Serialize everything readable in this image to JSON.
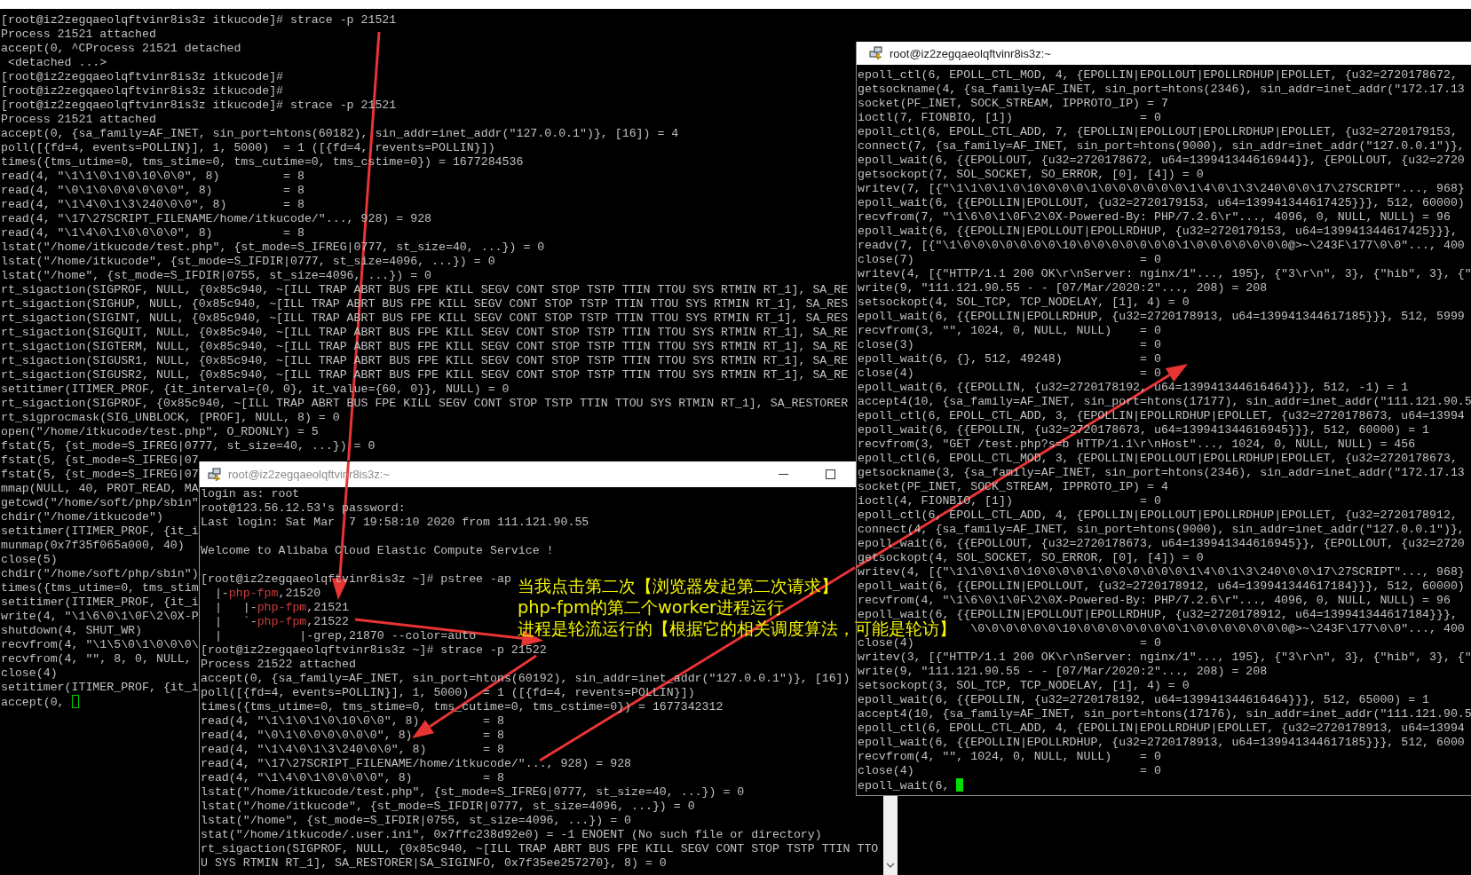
{
  "back_terminal": {
    "lines": [
      "[root@iz2zegqaeolqftvinr8is3z itkucode]# strace -p 21521",
      "Process 21521 attached",
      "accept(0, ^CProcess 21521 detached",
      " <detached ...>",
      "[root@iz2zegqaeolqftvinr8is3z itkucode]#",
      "[root@iz2zegqaeolqftvinr8is3z itkucode]#",
      "[root@iz2zegqaeolqftvinr8is3z itkucode]# strace -p 21521",
      "Process 21521 attached",
      "accept(0, {sa_family=AF_INET, sin_port=htons(60182), sin_addr=inet_addr(\"127.0.0.1\")}, [16]) = 4",
      "poll([{fd=4, events=POLLIN}], 1, 5000)  = 1 ([{fd=4, revents=POLLIN}])",
      "times({tms_utime=0, tms_stime=0, tms_cutime=0, tms_cstime=0}) = 1677284536",
      "read(4, \"\\1\\1\\0\\1\\0\\10\\0\\0\", 8)         = 8",
      "read(4, \"\\0\\1\\0\\0\\0\\0\\0\\0\", 8)          = 8",
      "read(4, \"\\1\\4\\0\\1\\3\\240\\0\\0\", 8)        = 8",
      "read(4, \"\\17\\27SCRIPT_FILENAME/home/itkucode/\"..., 928) = 928",
      "read(4, \"\\1\\4\\0\\1\\0\\0\\0\\0\", 8)          = 8",
      "lstat(\"/home/itkucode/test.php\", {st_mode=S_IFREG|0777, st_size=40, ...}) = 0",
      "lstat(\"/home/itkucode\", {st_mode=S_IFDIR|0777, st_size=4096, ...}) = 0",
      "lstat(\"/home\", {st_mode=S_IFDIR|0755, st_size=4096, ...}) = 0",
      "rt_sigaction(SIGPROF, NULL, {0x85c940, ~[ILL TRAP ABRT BUS FPE KILL SEGV CONT STOP TSTP TTIN TTOU SYS RTMIN RT_1], SA_RE",
      "rt_sigaction(SIGHUP, NULL, {0x85c940, ~[ILL TRAP ABRT BUS FPE KILL SEGV CONT STOP TSTP TTIN TTOU SYS RTMIN RT_1], SA_RES",
      "rt_sigaction(SIGINT, NULL, {0x85c940, ~[ILL TRAP ABRT BUS FPE KILL SEGV CONT STOP TSTP TTIN TTOU SYS RTMIN RT_1], SA_RES",
      "rt_sigaction(SIGQUIT, NULL, {0x85c940, ~[ILL TRAP ABRT BUS FPE KILL SEGV CONT STOP TSTP TTIN TTOU SYS RTMIN RT_1], SA_RE",
      "rt_sigaction(SIGTERM, NULL, {0x85c940, ~[ILL TRAP ABRT BUS FPE KILL SEGV CONT STOP TSTP TTIN TTOU SYS RTMIN RT_1], SA_RE",
      "rt_sigaction(SIGUSR1, NULL, {0x85c940, ~[ILL TRAP ABRT BUS FPE KILL SEGV CONT STOP TSTP TTIN TTOU SYS RTMIN RT_1], SA_RE",
      "rt_sigaction(SIGUSR2, NULL, {0x85c940, ~[ILL TRAP ABRT BUS FPE KILL SEGV CONT STOP TSTP TTIN TTOU SYS RTMIN RT_1], SA_RE",
      "setitimer(ITIMER_PROF, {it_interval={0, 0}, it_value={60, 0}}, NULL) = 0",
      "rt_sigaction(SIGPROF, {0x85c940, ~[ILL TRAP ABRT BUS FPE KILL SEGV CONT STOP TSTP TTIN TTOU SYS RTMIN RT_1], SA_RESTORER",
      "rt_sigprocmask(SIG_UNBLOCK, [PROF], NULL, 8) = 0",
      "open(\"/home/itkucode/test.php\", O_RDONLY) = 5",
      "fstat(5, {st_mode=S_IFREG|0777, st_size=40, ...}) = 0",
      "fstat(5, {st_mode=S_IFREG|07",
      "fstat(5, {st_mode=S_IFREG|07",
      "mmap(NULL, 40, PROT_READ, MA",
      "getcwd(\"/home/soft/php/sbin\"",
      "chdir(\"/home/itkucode\")",
      "setitimer(ITIMER_PROF, {it_i",
      "munmap(0x7f35f065a000, 40)",
      "close(5)",
      "chdir(\"/home/soft/php/sbin\")",
      "times({tms_utime=0, tms_stim",
      "setitimer(ITIMER_PROF, {it_i",
      "write(4, \"\\1\\6\\0\\1\\0F\\2\\0X-P",
      "shutdown(4, SHUT_WR)",
      "recvfrom(4, \"\\1\\5\\0\\1\\0\\0\\0\\",
      "recvfrom(4, \"\", 8, 0, NULL,",
      "close(4)",
      "setitimer(ITIMER_PROF, {it_i",
      {
        "kind": "prompt",
        "text": "accept(0, ",
        "cursor_filled": false
      }
    ]
  },
  "right_terminal": {
    "title": "root@iz2zegqaeolqftvinr8is3z:~",
    "active": true,
    "lines": [
      "epoll_ctl(6, EPOLL_CTL_MOD, 4, {EPOLLIN|EPOLLOUT|EPOLLRDHUP|EPOLLET, {u32=2720178672,",
      "getsockname(4, {sa_family=AF_INET, sin_port=htons(2346), sin_addr=inet_addr(\"172.17.13",
      "socket(PF_INET, SOCK_STREAM, IPPROTO_IP) = 7",
      "ioctl(7, FIONBIO, [1])                  = 0",
      "epoll_ctl(6, EPOLL_CTL_ADD, 7, {EPOLLIN|EPOLLOUT|EPOLLRDHUP|EPOLLET, {u32=2720179153,",
      "connect(7, {sa_family=AF_INET, sin_port=htons(9000), sin_addr=inet_addr(\"127.0.0.1\")},",
      "epoll_wait(6, {{EPOLLOUT, {u32=2720178672, u64=139941344616944}}, {EPOLLOUT, {u32=2720",
      "getsockopt(7, SOL_SOCKET, SO_ERROR, [0], [4]) = 0",
      "writev(7, [{\"\\1\\1\\0\\1\\0\\10\\0\\0\\0\\1\\0\\0\\0\\0\\0\\0\\1\\4\\0\\1\\3\\240\\0\\0\\17\\27SCRIPT\"..., 968}",
      "epoll_wait(6, {{EPOLLIN|EPOLLOUT, {u32=2720179153, u64=139941344617425}}}, 512, 60000)",
      "recvfrom(7, \"\\1\\6\\0\\1\\0F\\2\\0X-Powered-By: PHP/7.2.6\\r\"..., 4096, 0, NULL, NULL) = 96",
      "epoll_wait(6, {{EPOLLIN|EPOLLOUT|EPOLLRDHUP, {u32=2720179153, u64=139941344617425}}},",
      "readv(7, [{\"\\1\\0\\0\\0\\0\\0\\0\\0\\10\\0\\0\\0\\0\\0\\0\\0\\1\\0\\0\\0\\0\\0\\0\\0@>~\\243F\\177\\0\\0\"..., 400",
      "close(7)                                = 0",
      "writev(4, [{\"HTTP/1.1 200 OK\\r\\nServer: nginx/1\"..., 195}, {\"3\\r\\n\", 3}, {\"hib\", 3}, {\"",
      "write(9, \"111.121.90.55 - - [07/Mar/2020:2\"..., 208) = 208",
      "setsockopt(4, SOL_TCP, TCP_NODELAY, [1], 4) = 0",
      "epoll_wait(6, {{EPOLLIN|EPOLLRDHUP, {u32=2720178913, u64=139941344617185}}}, 512, 5999",
      "recvfrom(3, \"\", 1024, 0, NULL, NULL)    = 0",
      "close(3)                                = 0",
      "epoll_wait(6, {}, 512, 49248)           = 0",
      "close(4)                                = 0",
      "epoll_wait(6, {{EPOLLIN, {u32=2720178192, u64=139941344616464}}}, 512, -1) = 1",
      "accept4(10, {sa_family=AF_INET, sin_port=htons(17177), sin_addr=inet_addr(\"111.121.90.5",
      "epoll_ctl(6, EPOLL_CTL_ADD, 3, {EPOLLIN|EPOLLRDHUP|EPOLLET, {u32=2720178673, u64=13994",
      "epoll_wait(6, {{EPOLLIN, {u32=2720178673, u64=139941344616945}}}, 512, 60000) = 1",
      "recvfrom(3, \"GET /test.php?s=b HTTP/1.1\\r\\nHost\"..., 1024, 0, NULL, NULL) = 456",
      "epoll_ctl(6, EPOLL_CTL_MOD, 3, {EPOLLIN|EPOLLOUT|EPOLLRDHUP|EPOLLET, {u32=2720178673,",
      "getsockname(3, {sa_family=AF_INET, sin_port=htons(2346), sin_addr=inet_addr(\"172.17.13",
      "socket(PF_INET, SOCK_STREAM, IPPROTO_IP) = 4",
      "ioctl(4, FIONBIO, [1])                  = 0",
      "epoll_ctl(6, EPOLL_CTL_ADD, 4, {EPOLLIN|EPOLLOUT|EPOLLRDHUP|EPOLLET, {u32=2720178912,",
      "connect(4, {sa_family=AF_INET, sin_port=htons(9000), sin_addr=inet_addr(\"127.0.0.1\")},",
      "epoll_wait(6, {{EPOLLOUT, {u32=2720178673, u64=139941344616945}}, {EPOLLOUT, {u32=2720",
      "getsockopt(4, SOL_SOCKET, SO_ERROR, [0], [4]) = 0",
      "writev(4, [{\"\\1\\1\\0\\1\\0\\10\\0\\0\\0\\1\\0\\0\\0\\0\\0\\0\\1\\4\\0\\1\\3\\240\\0\\0\\17\\27SCRIPT\"..., 968}",
      "epoll_wait(6, {{EPOLLIN|EPOLLOUT, {u32=2720178912, u64=139941344617184}}}, 512, 60000)",
      "recvfrom(4, \"\\1\\6\\0\\1\\0F\\2\\0X-Powered-By: PHP/7.2.6\\r\"..., 4096, 0, NULL, NULL) = 96",
      "epoll_wait(6, {{EPOLLIN|EPOLLOUT|EPOLLRDHUP, {u32=2720178912, u64=139941344617184}}},",
      {
        "kind": "covered",
        "text": "\\0\\0\\0\\0\\0\\0\\10\\0\\0\\0\\0\\0\\0\\0\\1\\0\\0\\0\\0\\0\\0\\0@>~\\243F\\177\\0\\0\"..., 400"
      },
      "close(4)                                = 0",
      "writev(3, [{\"HTTP/1.1 200 OK\\r\\nServer: nginx/1\"..., 195}, {\"3\\r\\n\", 3}, {\"hib\", 3}, {\"",
      "write(9, \"111.121.90.55 - - [07/Mar/2020:2\"..., 208) = 208",
      "setsockopt(3, SOL_TCP, TCP_NODELAY, [1], 4) = 0",
      "epoll_wait(6, {{EPOLLIN, {u32=2720178192, u64=139941344616464}}}, 512, 65000) = 1",
      "accept4(10, {sa_family=AF_INET, sin_port=htons(17176), sin_addr=inet_addr(\"111.121.90.5",
      "epoll_ctl(6, EPOLL_CTL_ADD, 4, {EPOLLIN|EPOLLRDHUP|EPOLLET, {u32=2720178913, u64=13994",
      "epoll_wait(6, {{EPOLLIN|EPOLLRDHUP, {u32=2720178913, u64=139941344617185}}}, 512, 6000",
      "recvfrom(4, \"\", 1024, 0, NULL, NULL)    = 0",
      "close(4)                                = 0",
      {
        "kind": "prompt",
        "text": "epoll_wait(6, ",
        "cursor_filled": true
      }
    ]
  },
  "front_terminal": {
    "title": "root@iz2zegqaeolqftvinr8is3z:~",
    "active": false,
    "lines": [
      "login as: root",
      "root@123.56.12.53's password:",
      "Last login: Sat Mar  7 19:58:10 2020 from 111.121.90.55",
      {
        "kind": "blank"
      },
      "Welcome to Alibaba Cloud Elastic Compute Service !",
      {
        "kind": "blank"
      },
      "[root@iz2zegqaeolqftvinr8is3z ~]# pstree -ap",
      {
        "kind": "tree",
        "parts": [
          {
            "text": "  |-",
            "highlight": false
          },
          {
            "text": "php-fpm",
            "highlight": true
          },
          {
            "text": ",21520",
            "highlight": false
          }
        ]
      },
      {
        "kind": "tree",
        "parts": [
          {
            "text": "  |   |-",
            "highlight": false
          },
          {
            "text": "php-fpm",
            "highlight": true
          },
          {
            "text": ",21521",
            "highlight": false
          }
        ]
      },
      {
        "kind": "tree",
        "parts": [
          {
            "text": "  |   `-",
            "highlight": false
          },
          {
            "text": "php-fpm",
            "highlight": true
          },
          {
            "text": ",21522",
            "highlight": false
          }
        ]
      },
      "  |           |-grep,21870 --color=auto",
      "[root@iz2zegqaeolqftvinr8is3z ~]# strace -p 21522",
      "Process 21522 attached",
      "accept(0, {sa_family=AF_INET, sin_port=htons(60192), sin_addr=inet_addr(\"127.0.0.1\")}, [16])",
      "poll([{fd=4, events=POLLIN}], 1, 5000)  = 1 ([{fd=4, revents=POLLIN}])",
      "times({tms_utime=0, tms_stime=0, tms_cutime=0, tms_cstime=0}) = 1677342312",
      "read(4, \"\\1\\1\\0\\1\\0\\10\\0\\0\", 8)         = 8",
      "read(4, \"\\0\\1\\0\\0\\0\\0\\0\\0\", 8)          = 8",
      "read(4, \"\\1\\4\\0\\1\\3\\240\\0\\0\", 8)        = 8",
      "read(4, \"\\17\\27SCRIPT_FILENAME/home/itkucode/\"..., 928) = 928",
      "read(4, \"\\1\\4\\0\\1\\0\\0\\0\\0\", 8)          = 8",
      "lstat(\"/home/itkucode/test.php\", {st_mode=S_IFREG|0777, st_size=40, ...}) = 0",
      "lstat(\"/home/itkucode\", {st_mode=S_IFDIR|0777, st_size=4096, ...}) = 0",
      "lstat(\"/home\", {st_mode=S_IFDIR|0755, st_size=4096, ...}) = 0",
      "stat(\"/home/itkucode/.user.ini\", 0x7ffc238d92e0) = -1 ENOENT (No such file or directory)",
      "rt_sigaction(SIGPROF, NULL, {0x85c940, ~[ILL TRAP ABRT BUS FPE KILL SEGV CONT STOP TSTP TTIN TTO",
      "U SYS RTMIN RT_1], SA_RESTORER|SA_SIGINFO, 0x7f35ee257270}, 8) = 0"
    ]
  },
  "annotation": {
    "lines": [
      "当我点击第二次【浏览器发起第二次请求】",
      "php-fpm的第二个worker进程运行",
      "进程是轮流运行的【根据它的相关调度算法，可能是轮访】"
    ]
  }
}
